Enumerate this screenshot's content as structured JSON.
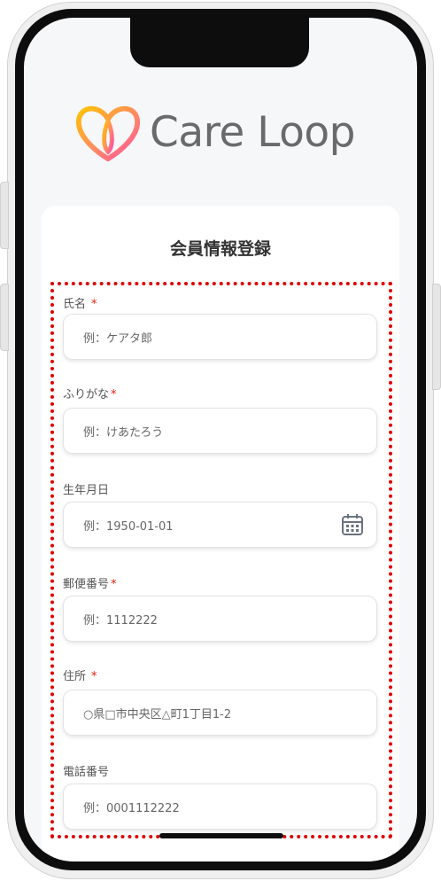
{
  "app": {
    "logo_text": "Care Loop",
    "logo_icon": "heart-loop-logo",
    "accent_colors": [
      "#ffc107",
      "#ff5fa2"
    ]
  },
  "form": {
    "title": "会員情報登録",
    "required_mark": "*",
    "fields": [
      {
        "label": "氏名",
        "required": true,
        "placeholder": "例：ケアタ郎"
      },
      {
        "label": "ふりがな",
        "required": true,
        "placeholder": "例：けあたろう"
      },
      {
        "label": "生年月日",
        "required": false,
        "placeholder": "例：1950-01-01",
        "icon": "calendar-icon"
      },
      {
        "label": "郵便番号",
        "required": true,
        "placeholder": "例：1112222"
      },
      {
        "label": "住所",
        "required": true,
        "placeholder": "○県□市中央区△町1丁目1-2"
      },
      {
        "label": "電話番号",
        "required": false,
        "placeholder": "例：0001112222"
      }
    ]
  },
  "highlight_color": "#e00000"
}
